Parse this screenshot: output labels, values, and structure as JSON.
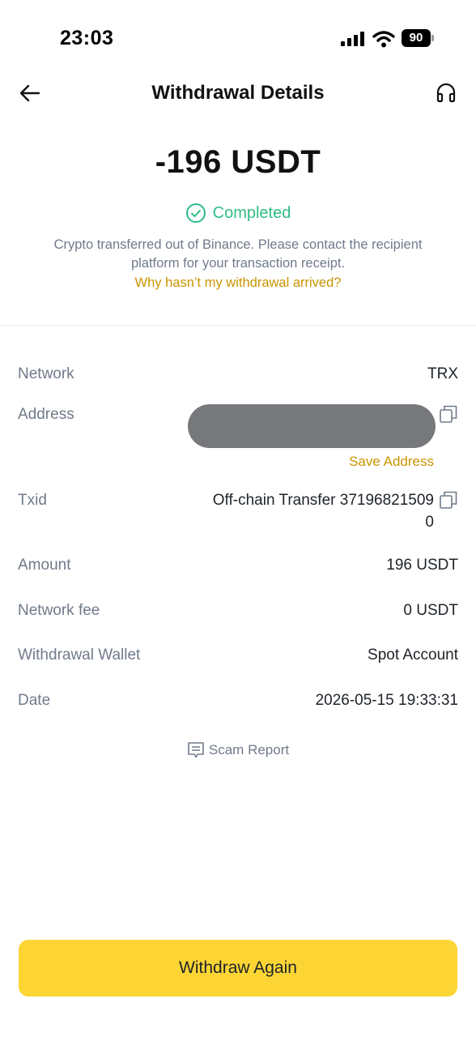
{
  "status_bar": {
    "time": "23:03",
    "battery": "90"
  },
  "header": {
    "title": "Withdrawal Details"
  },
  "summary": {
    "amount": "-196 USDT",
    "status": "Completed",
    "description": "Crypto transferred out of Binance. Please contact the recipient platform for your transaction receipt.",
    "help_link": "Why hasn’t my withdrawal arrived?"
  },
  "details": {
    "network": {
      "label": "Network",
      "value": "TRX"
    },
    "address": {
      "label": "Address",
      "save_label": "Save Address"
    },
    "txid": {
      "label": "Txid",
      "value_line1": "Off-chain Transfer 37196821509",
      "value_line2": "0"
    },
    "amount": {
      "label": "Amount",
      "value": "196 USDT"
    },
    "network_fee": {
      "label": "Network fee",
      "value": "0 USDT"
    },
    "wallet": {
      "label": "Withdrawal Wallet",
      "value": "Spot Account"
    },
    "date": {
      "label": "Date",
      "value": "2026-05-15 19:33:31"
    }
  },
  "scam_report": {
    "label": "Scam Report"
  },
  "footer": {
    "button_label": "Withdraw Again"
  },
  "colors": {
    "accent": "#fcd535",
    "success": "#2ebd85",
    "link": "#c99400",
    "muted": "#707a8a"
  },
  "icons": [
    "back-arrow-icon",
    "headset-icon",
    "check-circle-icon",
    "copy-icon",
    "scam-report-icon",
    "signal-icon",
    "wifi-icon",
    "battery-icon"
  ]
}
